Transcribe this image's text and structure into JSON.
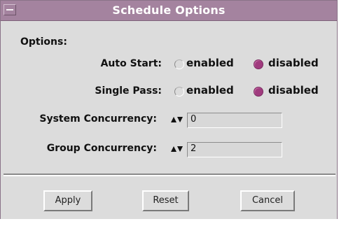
{
  "window": {
    "title": "Schedule Options"
  },
  "options": {
    "section_label": "Options:",
    "auto_start": {
      "label": "Auto Start:",
      "enabled_label": "enabled",
      "disabled_label": "disabled",
      "selected": "disabled"
    },
    "single_pass": {
      "label": "Single Pass:",
      "enabled_label": "enabled",
      "disabled_label": "disabled",
      "selected": "disabled"
    },
    "system_concurrency": {
      "label": "System Concurrency:",
      "value": "0"
    },
    "group_concurrency": {
      "label": "Group Concurrency:",
      "value": "2"
    }
  },
  "buttons": {
    "apply": "Apply",
    "reset": "Reset",
    "cancel": "Cancel"
  },
  "colors": {
    "titlebar": "#a4839f",
    "radio_selected": "#a03b7e",
    "background": "#dcdcdc"
  }
}
